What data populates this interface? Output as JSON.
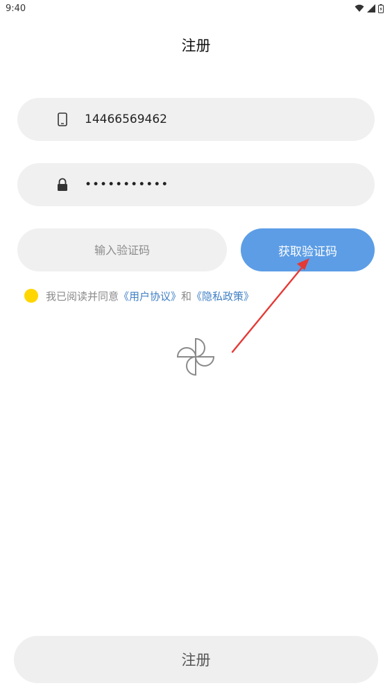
{
  "status_bar": {
    "time": "9:40",
    "icons": [
      "wifi-icon",
      "signal-icon",
      "battery-icon"
    ]
  },
  "header": {
    "title": "注册"
  },
  "form": {
    "phone": {
      "value": "14466569462",
      "icon": "phone-icon"
    },
    "password": {
      "masked_value": "•••••••••••",
      "icon": "lock-icon"
    },
    "verification_code": {
      "placeholder": "输入验证码",
      "value": ""
    },
    "get_code_label": "获取验证码"
  },
  "agreement": {
    "prefix": "我已阅读并同意",
    "user_agreement": "《用户协议》",
    "conjunction": "和",
    "privacy_policy": "《隐私政策》",
    "checked": true
  },
  "register_label": "注册",
  "colors": {
    "primary_button": "#5c9de6",
    "field_background": "#f0f0f0",
    "radio": "#ffd600",
    "link": "#3f7fc4",
    "annotation_arrow": "#e53935"
  }
}
